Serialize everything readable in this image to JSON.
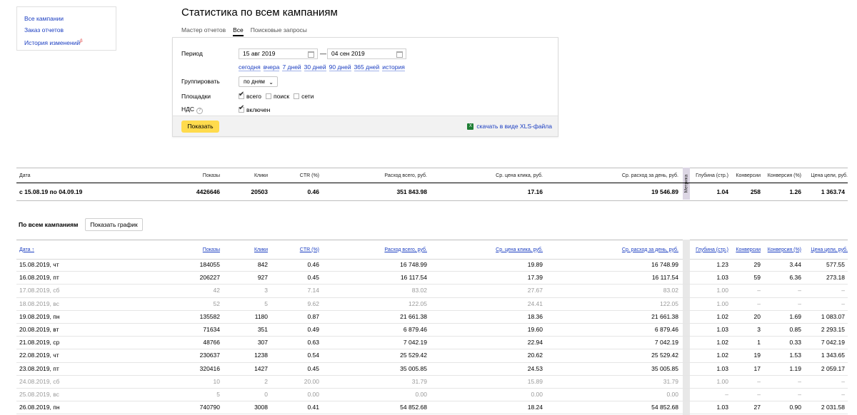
{
  "sidebar": {
    "links": [
      "Все кампании",
      "Заказ отчетов",
      "История изменений"
    ],
    "history_mark": "β"
  },
  "page": {
    "title": "Статистика по всем кампаниям"
  },
  "tabs": [
    {
      "label": "Мастер отчетов",
      "active": false
    },
    {
      "label": "Все",
      "active": true
    },
    {
      "label": "Поисковые запросы",
      "active": false
    }
  ],
  "filters": {
    "period_label": "Период",
    "date_from": "15 авг 2019",
    "date_to": "04 сен 2019",
    "dash": "—",
    "presets": [
      "сегодня",
      "вчера",
      "7 дней",
      "30 дней",
      "90 дней",
      "365 дней",
      "история"
    ],
    "group_label": "Группировать",
    "group_value": "по дням",
    "platforms_label": "Площадки",
    "platforms": [
      {
        "label": "всего",
        "checked": true
      },
      {
        "label": "поиск",
        "checked": false
      },
      {
        "label": "сети",
        "checked": false
      }
    ],
    "vat_label": "НДС",
    "vat_help": "?",
    "vat_option": "включен",
    "vat_checked": true,
    "show_button": "Показать",
    "xls_link": "скачать в виде XLS-файла",
    "xls_icon": "excel-icon"
  },
  "summary": {
    "headers": [
      "Дата",
      "Показы",
      "Клики",
      "CTR (%)",
      "Расход всего, руб.",
      "Ср. цена клика, руб.",
      "Ср. расход за день, руб.",
      "Глубина (стр.)",
      "Конверсии",
      "Конверсия (%)",
      "Цена цели, руб."
    ],
    "metrika_label": "Метрика",
    "row": [
      "с 15.08.19 по 04.09.19",
      "4426646",
      "20503",
      "0.46",
      "351 843.98",
      "17.16",
      "19 546.89",
      "1.04",
      "258",
      "1.26",
      "1 363.74"
    ]
  },
  "campaigns": {
    "title": "По всем кампаниям",
    "graph_button": "Показать график",
    "headers": [
      "Дата ↑",
      "Показы",
      "Клики",
      "CTR (%)",
      "Расход всего, руб.",
      "Ср. цена клика, руб.",
      "Ср. расход за день, руб.",
      "Глубина (стр.)",
      "Конверсии",
      "Конверсия (%)",
      "Цена цели, руб."
    ],
    "rows": [
      {
        "muted": false,
        "cells": [
          "15.08.2019, чт",
          "184055",
          "842",
          "0.46",
          "16 748.99",
          "19.89",
          "16 748.99",
          "1.23",
          "29",
          "3.44",
          "577.55"
        ]
      },
      {
        "muted": false,
        "cells": [
          "16.08.2019, пт",
          "206227",
          "927",
          "0.45",
          "16 117.54",
          "17.39",
          "16 117.54",
          "1.03",
          "59",
          "6.36",
          "273.18"
        ]
      },
      {
        "muted": true,
        "cells": [
          "17.08.2019, сб",
          "42",
          "3",
          "7.14",
          "83.02",
          "27.67",
          "83.02",
          "1.00",
          "–",
          "–",
          "–"
        ]
      },
      {
        "muted": true,
        "cells": [
          "18.08.2019, вс",
          "52",
          "5",
          "9.62",
          "122.05",
          "24.41",
          "122.05",
          "1.00",
          "–",
          "–",
          "–"
        ]
      },
      {
        "muted": false,
        "cells": [
          "19.08.2019, пн",
          "135582",
          "1180",
          "0.87",
          "21 661.38",
          "18.36",
          "21 661.38",
          "1.02",
          "20",
          "1.69",
          "1 083.07"
        ]
      },
      {
        "muted": false,
        "cells": [
          "20.08.2019, вт",
          "71634",
          "351",
          "0.49",
          "6 879.46",
          "19.60",
          "6 879.46",
          "1.03",
          "3",
          "0.85",
          "2 293.15"
        ]
      },
      {
        "muted": false,
        "cells": [
          "21.08.2019, ср",
          "48766",
          "307",
          "0.63",
          "7 042.19",
          "22.94",
          "7 042.19",
          "1.02",
          "1",
          "0.33",
          "7 042.19"
        ]
      },
      {
        "muted": false,
        "cells": [
          "22.08.2019, чт",
          "230637",
          "1238",
          "0.54",
          "25 529.42",
          "20.62",
          "25 529.42",
          "1.02",
          "19",
          "1.53",
          "1 343.65"
        ]
      },
      {
        "muted": false,
        "cells": [
          "23.08.2019, пт",
          "320416",
          "1427",
          "0.45",
          "35 005.85",
          "24.53",
          "35 005.85",
          "1.03",
          "17",
          "1.19",
          "2 059.17"
        ]
      },
      {
        "muted": true,
        "cells": [
          "24.08.2019, сб",
          "10",
          "2",
          "20.00",
          "31.79",
          "15.89",
          "31.79",
          "1.00",
          "–",
          "–",
          "–"
        ]
      },
      {
        "muted": true,
        "cells": [
          "25.08.2019, вс",
          "5",
          "0",
          "0.00",
          "0.00",
          "0.00",
          "0.00",
          "–",
          "–",
          "–",
          "–"
        ]
      },
      {
        "muted": false,
        "cells": [
          "26.08.2019, пн",
          "740790",
          "3008",
          "0.41",
          "54 852.68",
          "18.24",
          "54 852.68",
          "1.03",
          "27",
          "0.90",
          "2 031.58"
        ]
      }
    ]
  }
}
